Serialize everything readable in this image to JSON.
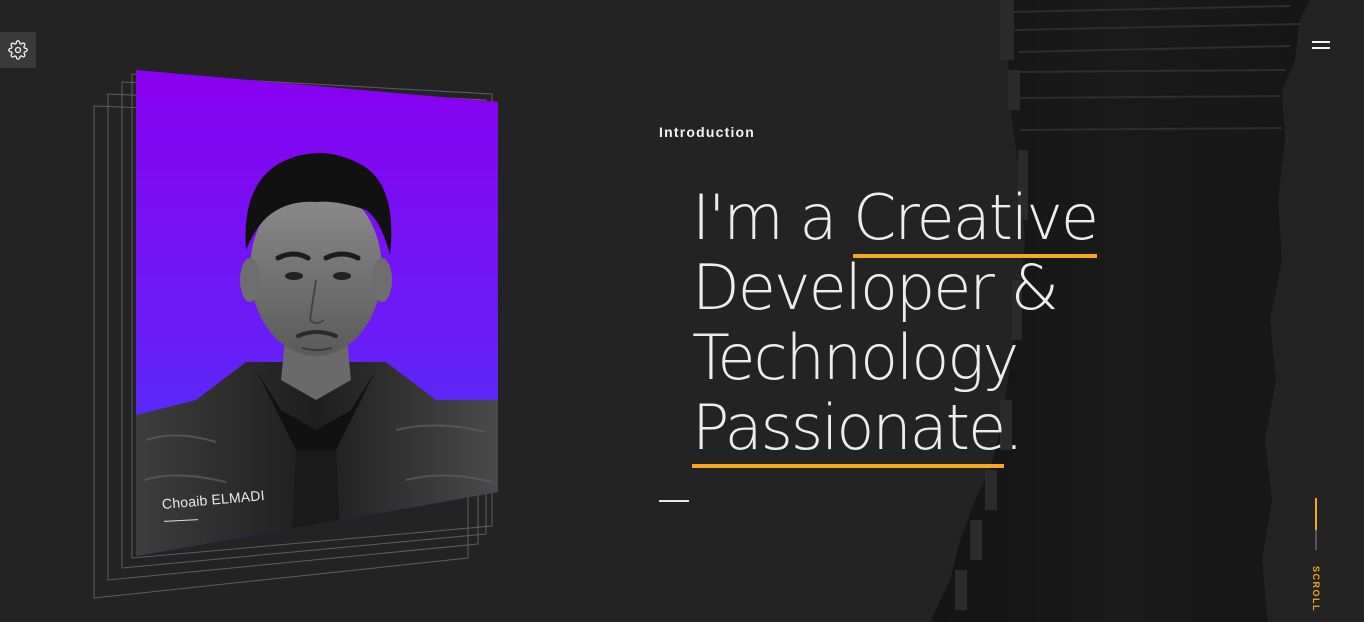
{
  "settings": {
    "icon": "gear-icon"
  },
  "menu": {
    "icon": "hamburger-icon"
  },
  "portrait": {
    "caption": "Choaib ELMADI",
    "gradient_top": "#8a00f0",
    "gradient_bottom": "#4a35ff"
  },
  "intro": {
    "label": "Introduction",
    "headline": {
      "line1_plain": "I'm a ",
      "line1_highlight": "Creative",
      "line2": "Developer &",
      "line3": "Technology",
      "line4_highlight": "Passionate",
      "line4_suffix": "."
    }
  },
  "scroll": {
    "label": "SCROLL"
  },
  "colors": {
    "background": "#232323",
    "accent": "#f5a623",
    "text": "#ededed"
  }
}
